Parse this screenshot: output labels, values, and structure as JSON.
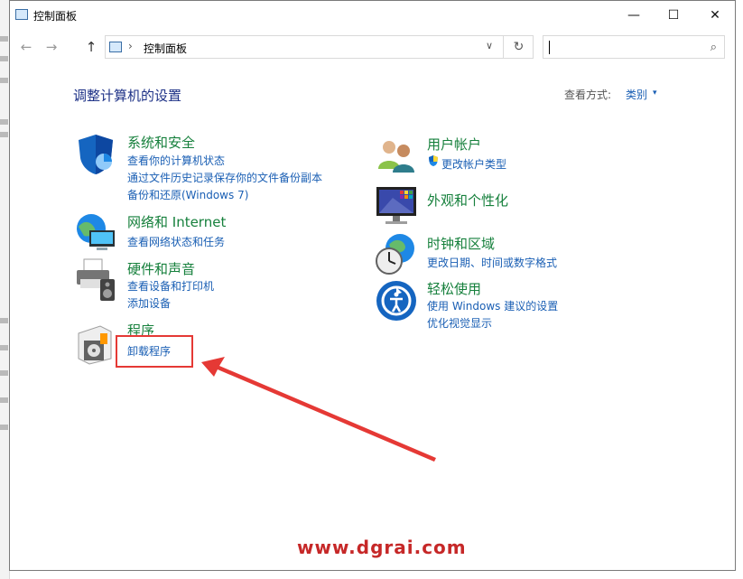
{
  "window": {
    "title": "控制面板"
  },
  "controls": {
    "minimize": "—",
    "maximize": "☐",
    "close": "✕"
  },
  "nav": {
    "back": "←",
    "forward": "→",
    "up": "↑"
  },
  "address": {
    "separator": "›",
    "path": "控制面板",
    "dropdown": "∨",
    "refresh": "↻"
  },
  "search": {
    "placeholder": "",
    "icon": "⌕"
  },
  "heading": "调整计算机的设置",
  "view": {
    "label": "查看方式:",
    "value": "类别",
    "arrow": "▾"
  },
  "categories": [
    {
      "title": "系统和安全",
      "icon": "shield-icon",
      "links": [
        "查看你的计算机状态",
        "通过文件历史记录保存你的文件备份副本",
        "备份和还原(Windows 7)"
      ]
    },
    {
      "title": "网络和 Internet",
      "icon": "network-globe-icon",
      "links": [
        "查看网络状态和任务"
      ]
    },
    {
      "title": "硬件和声音",
      "icon": "printer-speaker-icon",
      "links": [
        "查看设备和打印机",
        "添加设备"
      ]
    },
    {
      "title": "程序",
      "icon": "programs-disc-icon",
      "links": [
        "卸载程序"
      ]
    },
    {
      "title": "用户帐户",
      "icon": "users-icon",
      "links": [
        "更改帐户类型"
      ]
    },
    {
      "title": "外观和个性化",
      "icon": "monitor-palette-icon",
      "links": []
    },
    {
      "title": "时钟和区域",
      "icon": "clock-globe-icon",
      "links": [
        "更改日期、时间或数字格式"
      ]
    },
    {
      "title": "轻松使用",
      "icon": "ease-of-access-icon",
      "links": [
        "使用 Windows 建议的设置",
        "优化视觉显示"
      ]
    }
  ],
  "annotation": {
    "highlight_color": "#e53935"
  },
  "watermark": "www.dgrai.com",
  "colors": {
    "title_green": "#16803c",
    "link_blue": "#1a5fb4",
    "heading_blue": "#1e3287"
  }
}
